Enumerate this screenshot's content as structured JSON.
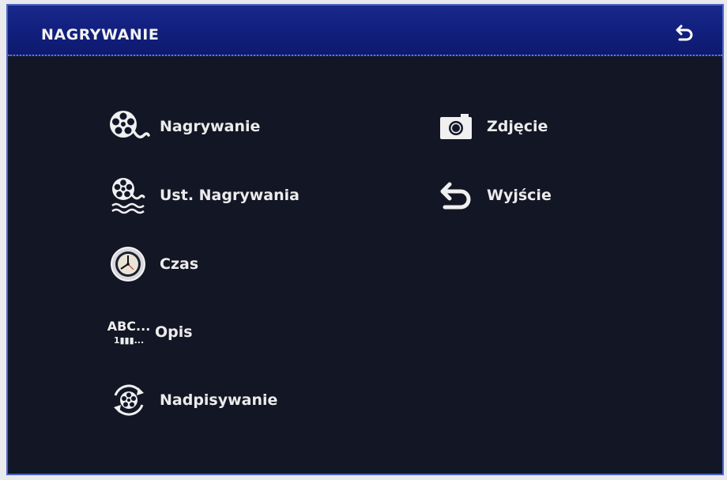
{
  "header": {
    "title": "NAGRYWANIE",
    "back_icon": "back-arrow-icon"
  },
  "menu_left": [
    {
      "label": "Nagrywanie",
      "icon": "film-reel-icon"
    },
    {
      "label": "Ust. Nagrywania",
      "icon": "film-reel-settings-icon"
    },
    {
      "label": "Czas",
      "icon": "clock-icon"
    },
    {
      "label": "Opis",
      "icon": "abc-text-icon",
      "icon_text_top": "ABC...",
      "icon_text_bottom": "1▮▮▮..."
    },
    {
      "label": "Nadpisywanie",
      "icon": "overwrite-reel-icon"
    }
  ],
  "menu_right": [
    {
      "label": "Zdjęcie",
      "icon": "camera-icon"
    },
    {
      "label": "Wyjście",
      "icon": "back-arrow-icon"
    }
  ],
  "colors": {
    "background": "#121728",
    "header": "#122080",
    "border": "#4b66c5",
    "text": "#ececec"
  }
}
